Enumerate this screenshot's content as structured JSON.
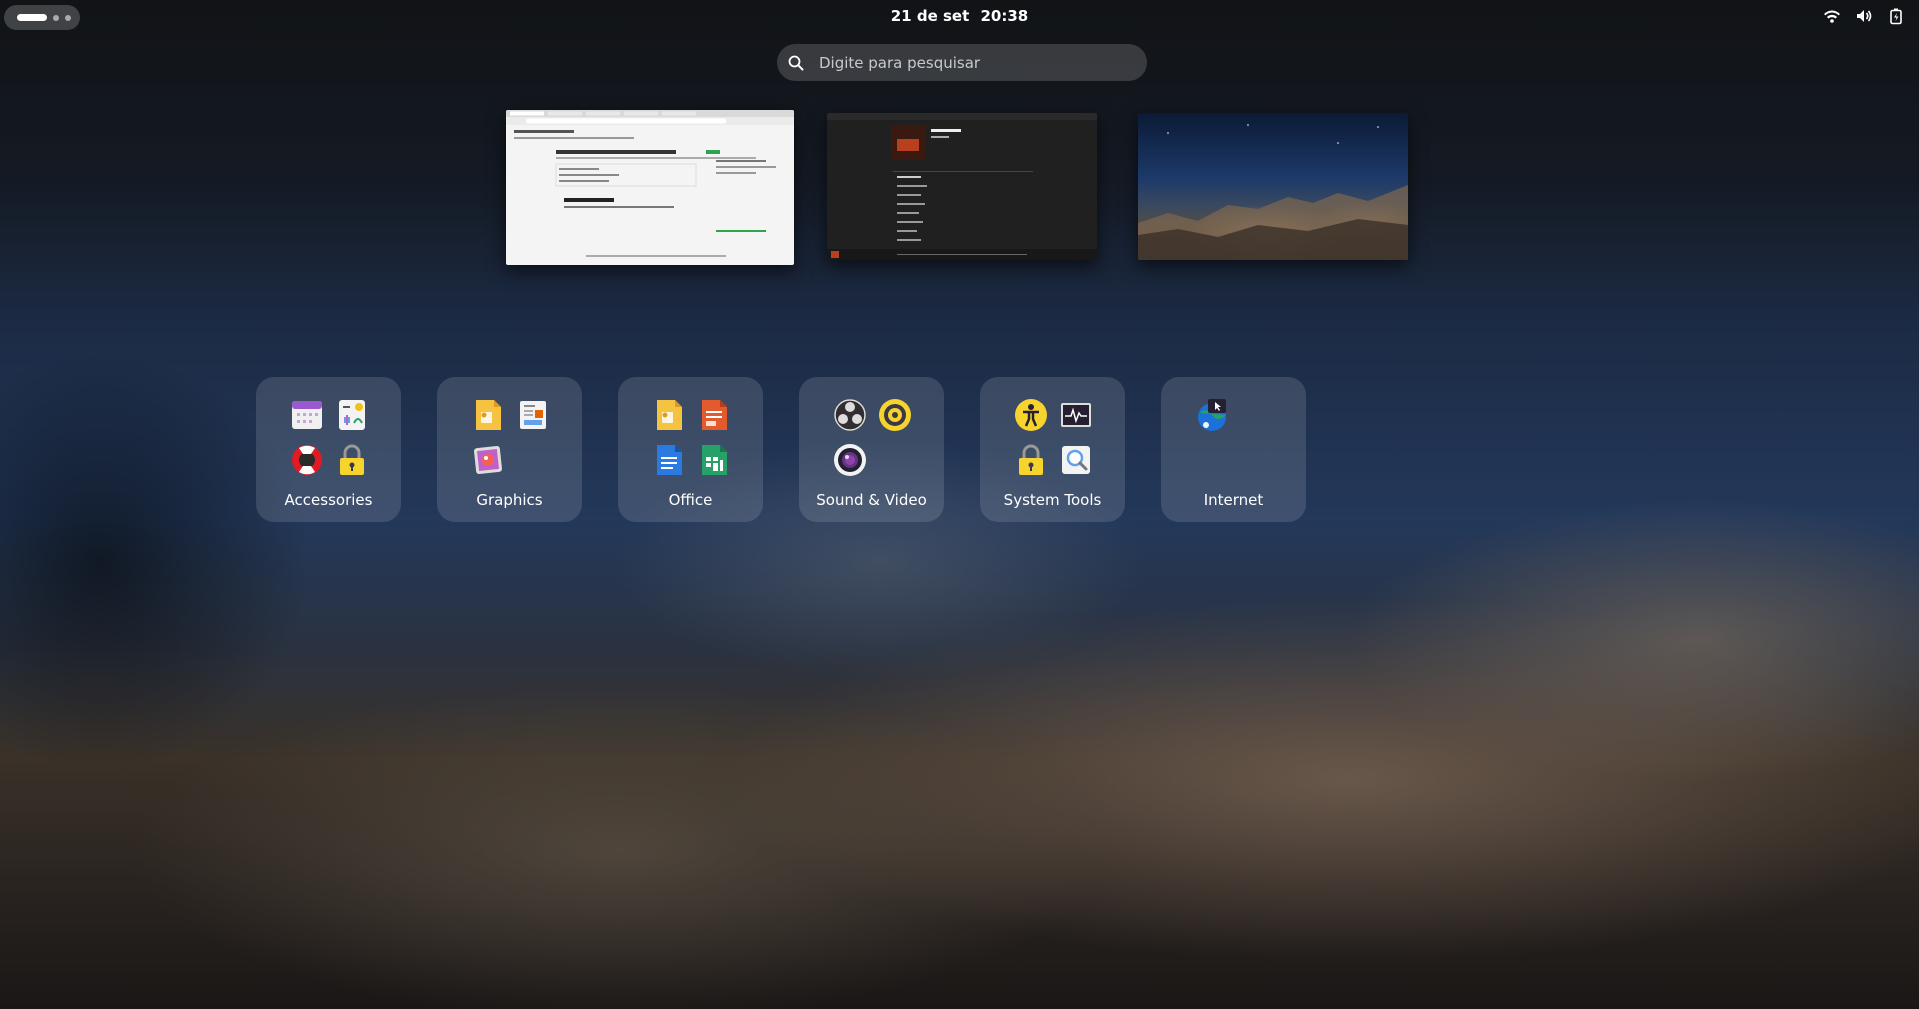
{
  "topbar": {
    "date": "21 de set",
    "time": "20:38",
    "indicators": [
      "wifi-icon",
      "volume-icon",
      "battery-icon"
    ]
  },
  "search": {
    "placeholder": "Digite para pesquisar"
  },
  "workspaces": [
    {
      "name": "workspace-1",
      "content": "browser-window"
    },
    {
      "name": "workspace-2",
      "content": "music-player-window"
    },
    {
      "name": "workspace-3",
      "content": "empty-desktop"
    }
  ],
  "folders": [
    {
      "label": "Accessories",
      "icons": [
        "calendar-icon",
        "characters-icon",
        "help-icon",
        "passwords-icon"
      ]
    },
    {
      "label": "Graphics",
      "icons": [
        "impress-icon",
        "document-viewer-icon",
        "image-viewer-icon"
      ]
    },
    {
      "label": "Office",
      "icons": [
        "impress-icon",
        "impress-remote-icon",
        "writer-icon",
        "calc-icon"
      ]
    },
    {
      "label": "Sound & Video",
      "icons": [
        "obs-icon",
        "rhythmbox-icon",
        "camera-icon"
      ]
    },
    {
      "label": "System Tools",
      "icons": [
        "accessibility-icon",
        "system-monitor-icon",
        "passwords-icon",
        "disk-usage-icon"
      ]
    },
    {
      "label": "Internet",
      "icons": [
        "remote-desktop-icon"
      ]
    }
  ]
}
